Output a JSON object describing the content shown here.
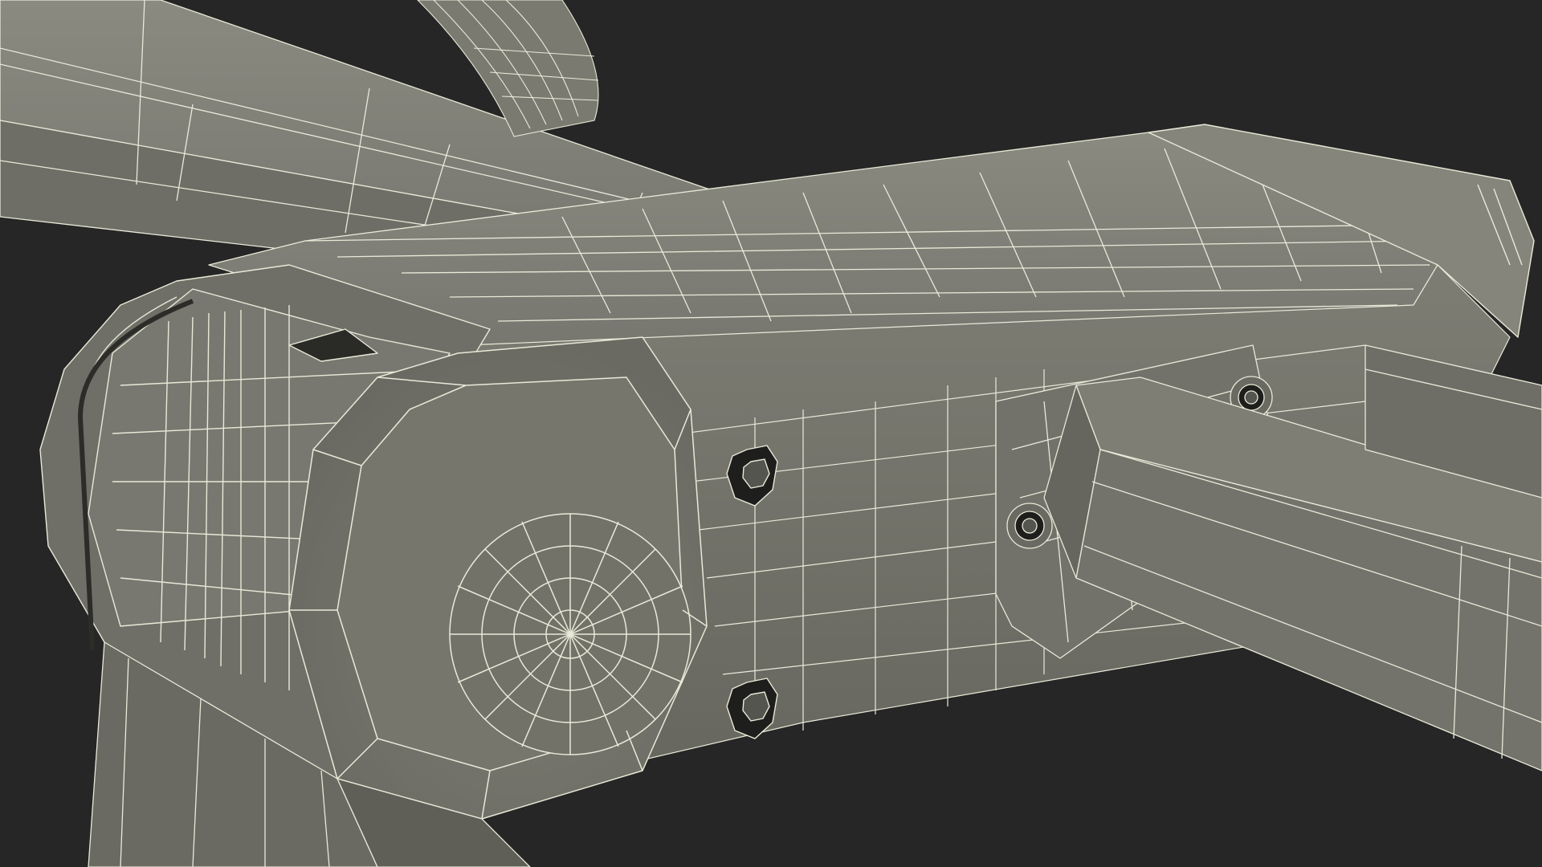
{
  "scene": {
    "background_color": "#262626",
    "mesh_fill_color": "#7a7a70",
    "mesh_shadow_color": "#5c5c54",
    "mesh_highlight_color": "#8a8a80",
    "wire_color": "#e8ead8",
    "hole_color": "#1e1e1c",
    "render_mode": "wireframe-over-shaded"
  }
}
